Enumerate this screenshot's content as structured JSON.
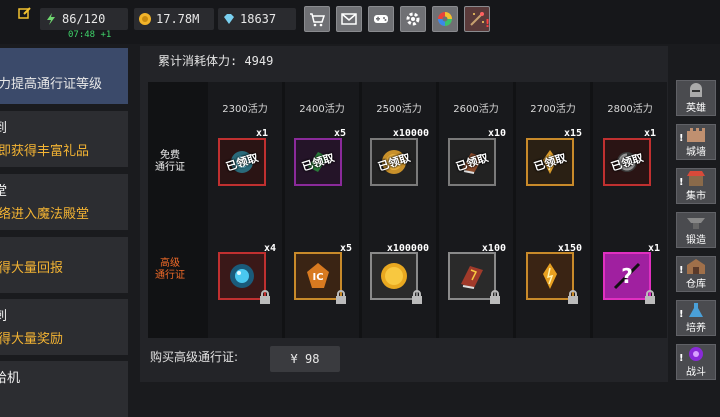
{
  "topbar": {
    "energy": "86/120",
    "timer": "07:48 +1",
    "gold": "17.78M",
    "gems": "18637",
    "buttons": [
      "shop",
      "mail",
      "gamepad",
      "settings",
      "color-wheel",
      "sparkle"
    ]
  },
  "sidebar": {
    "items": [
      {
        "title": " ",
        "desc": "力提高通行证等级"
      },
      {
        "title": "到",
        "desc": "即获得丰富礼品"
      },
      {
        "title": "堂",
        "desc": "络进入魔法殿堂"
      },
      {
        "title": "",
        "desc": "得大量回报"
      },
      {
        "title": "刺",
        "desc": "得大量奖励"
      },
      {
        "title": "给机",
        "desc": ""
      }
    ]
  },
  "pass": {
    "total_label": "累计消耗体力: 4949",
    "free_label_1": "免费",
    "free_label_2": "通行证",
    "premium_label_1": "高级",
    "premium_label_2": "通行证",
    "claimed": "已领取",
    "buy_label": "购买高级通行证:",
    "price": "¥ 98",
    "tiers": [
      {
        "cost": "2300活力",
        "free_qty": "x1",
        "prem_qty": "x4"
      },
      {
        "cost": "2400活力",
        "free_qty": "x5",
        "prem_qty": "x5"
      },
      {
        "cost": "2500活力",
        "free_qty": "x10000",
        "prem_qty": "x100000"
      },
      {
        "cost": "2600活力",
        "free_qty": "x10",
        "prem_qty": "x100"
      },
      {
        "cost": "2700活力",
        "free_qty": "x15",
        "prem_qty": "x150"
      },
      {
        "cost": "2800活力",
        "free_qty": "x1",
        "prem_qty": "x1"
      }
    ]
  },
  "rightnav": {
    "items": [
      "英雄",
      "城墙",
      "集市",
      "锻造",
      "仓库",
      "培养",
      "战斗"
    ]
  },
  "colors": {
    "accent_gold": "#f4b433",
    "premium_label": "#f06a28",
    "free_label": "#f0f0f0",
    "timer_green": "#3fd46a",
    "alert_red": "#ff4040"
  }
}
